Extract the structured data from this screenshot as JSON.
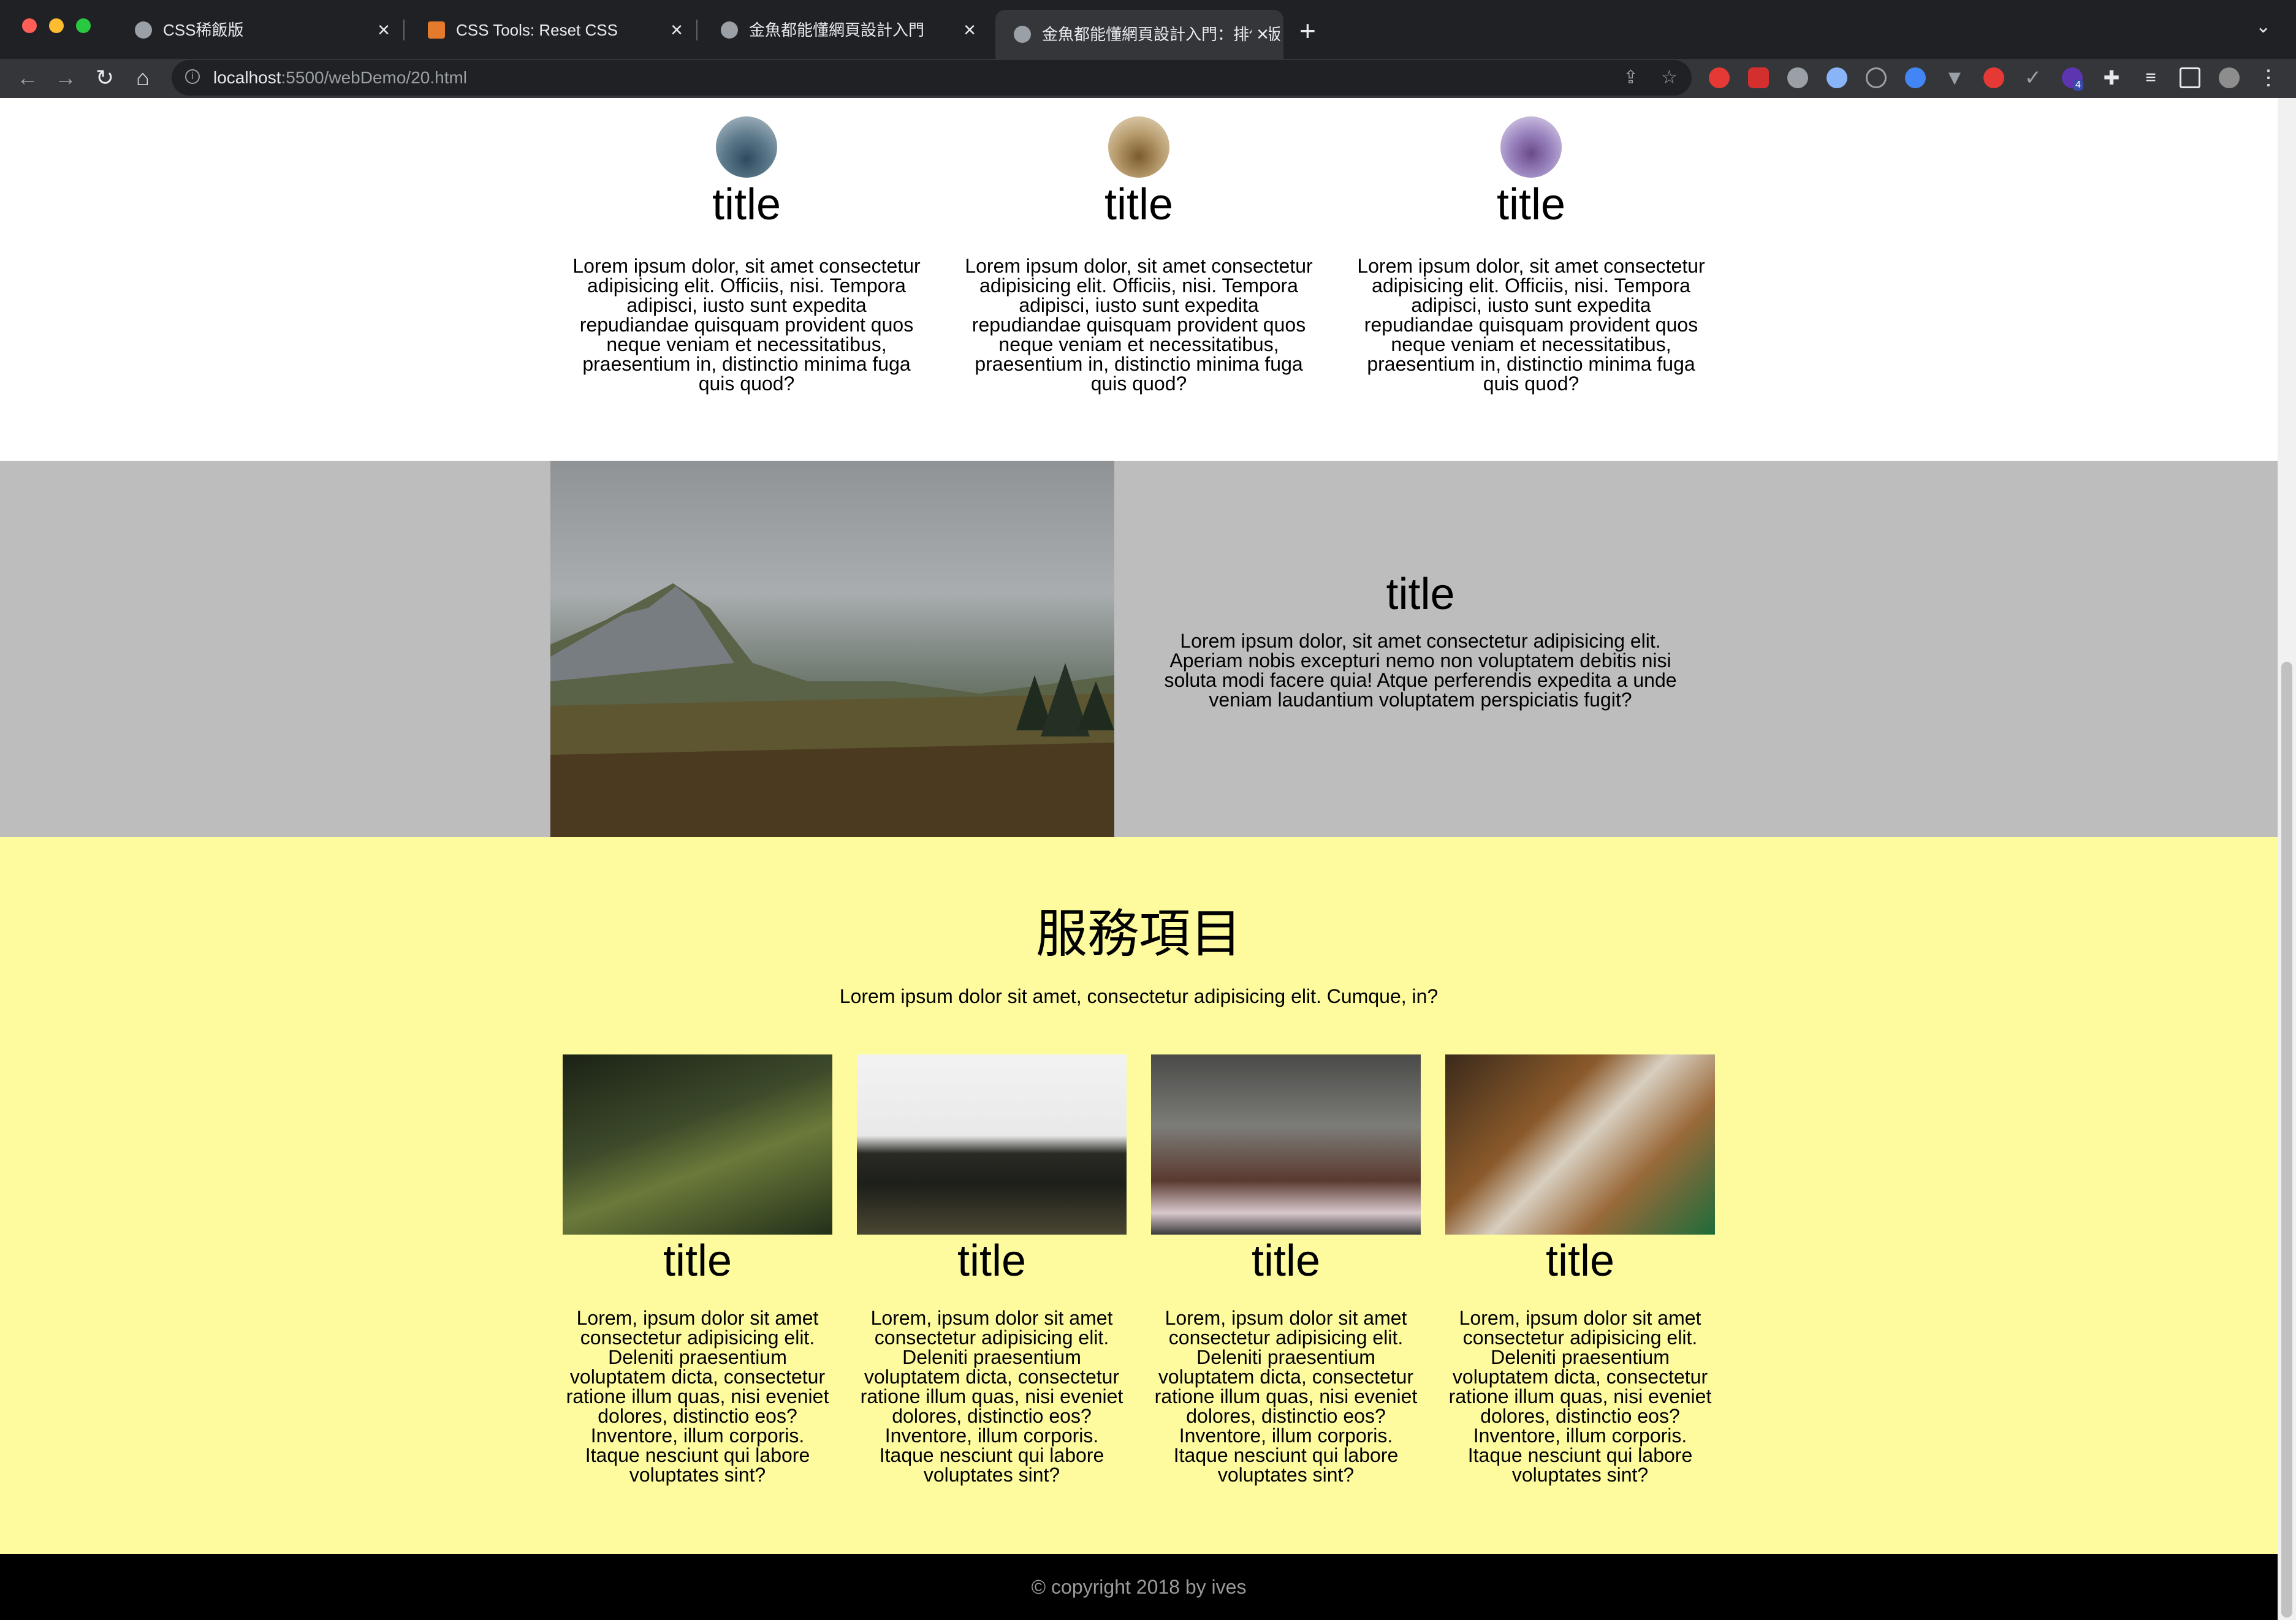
{
  "browser": {
    "tabs": [
      {
        "title": "CSS稀飯版",
        "active": false
      },
      {
        "title": "CSS Tools: Reset CSS",
        "active": false
      },
      {
        "title": "金魚都能懂網頁設計入門",
        "active": false
      },
      {
        "title": "金魚都能懂網頁設計入門：排個版",
        "active": true
      }
    ],
    "url_host": "localhost",
    "url_path": ":5500/webDemo/20.html",
    "extension_badge": "4"
  },
  "features": [
    {
      "title": "title",
      "text": "Lorem ipsum dolor, sit amet consectetur adipisicing elit. Officiis, nisi. Tempora adipisci, iusto sunt expedita repudiandae quisquam provident quos neque veniam et necessitatibus, praesentium in, distinctio minima fuga quis quod?"
    },
    {
      "title": "title",
      "text": "Lorem ipsum dolor, sit amet consectetur adipisicing elit. Officiis, nisi. Tempora adipisci, iusto sunt expedita repudiandae quisquam provident quos neque veniam et necessitatibus, praesentium in, distinctio minima fuga quis quod?"
    },
    {
      "title": "title",
      "text": "Lorem ipsum dolor, sit amet consectetur adipisicing elit. Officiis, nisi. Tempora adipisci, iusto sunt expedita repudiandae quisquam provident quos neque veniam et necessitatibus, praesentium in, distinctio minima fuga quis quod?"
    }
  ],
  "about": {
    "title": "title",
    "text": "Lorem ipsum dolor, sit amet consectetur adipisicing elit. Aperiam nobis excepturi nemo non voluptatem debitis nisi soluta modi facere quia! Atque perferendis expedita a unde veniam laudantium voluptatem perspiciatis fugit?"
  },
  "services": {
    "heading": "服務項目",
    "subtitle": "Lorem ipsum dolor sit amet, consectetur adipisicing elit. Cumque, in?",
    "cards": [
      {
        "title": "title",
        "text": "Lorem, ipsum dolor sit amet consectetur adipisicing elit. Deleniti praesentium voluptatem dicta, consectetur ratione illum quas, nisi eveniet dolores, distinctio eos? Inventore, illum corporis. Itaque nesciunt qui labore voluptates sint?"
      },
      {
        "title": "title",
        "text": "Lorem, ipsum dolor sit amet consectetur adipisicing elit. Deleniti praesentium voluptatem dicta, consectetur ratione illum quas, nisi eveniet dolores, distinctio eos? Inventore, illum corporis. Itaque nesciunt qui labore voluptates sint?"
      },
      {
        "title": "title",
        "text": "Lorem, ipsum dolor sit amet consectetur adipisicing elit. Deleniti praesentium voluptatem dicta, consectetur ratione illum quas, nisi eveniet dolores, distinctio eos? Inventore, illum corporis. Itaque nesciunt qui labore voluptates sint?"
      },
      {
        "title": "title",
        "text": "Lorem, ipsum dolor sit amet consectetur adipisicing elit. Deleniti praesentium voluptatem dicta, consectetur ratione illum quas, nisi eveniet dolores, distinctio eos? Inventore, illum corporis. Itaque nesciunt qui labore voluptates sint?"
      }
    ]
  },
  "footer": {
    "text": "© copyright 2018 by ives"
  },
  "colors": {
    "gray_band": "#bdbdbd",
    "yellow_band": "#fdfb9d",
    "footer_bg": "#000000"
  }
}
